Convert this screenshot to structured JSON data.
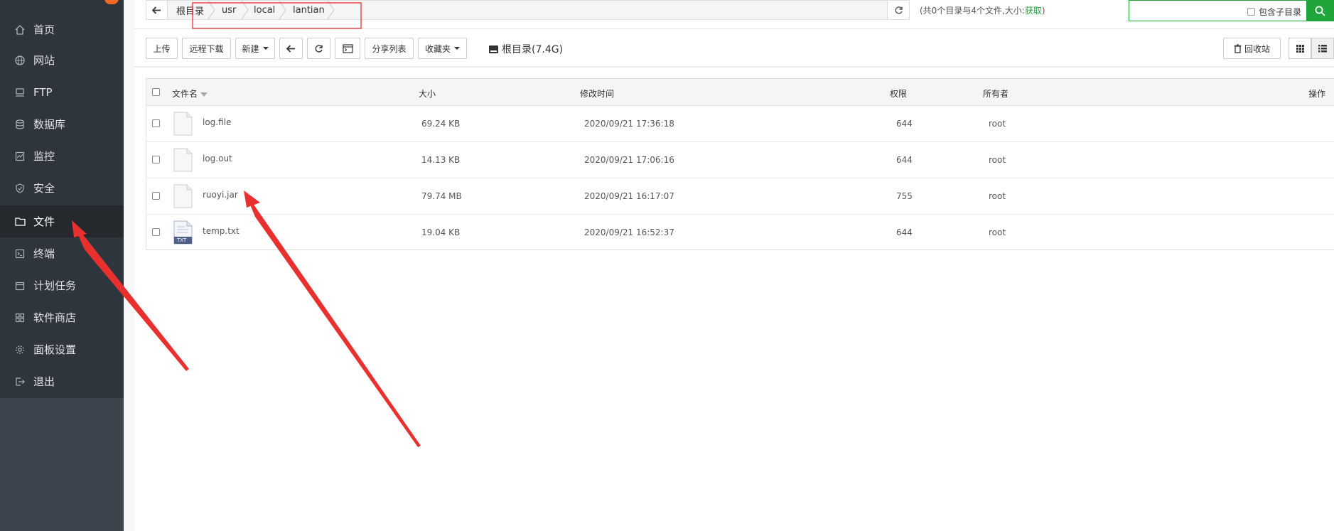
{
  "sidebar": {
    "items": [
      {
        "label": "首页",
        "icon": "home-icon"
      },
      {
        "label": "网站",
        "icon": "globe-icon"
      },
      {
        "label": "FTP",
        "icon": "ftp-icon"
      },
      {
        "label": "数据库",
        "icon": "database-icon"
      },
      {
        "label": "监控",
        "icon": "monitor-icon"
      },
      {
        "label": "安全",
        "icon": "shield-icon"
      },
      {
        "label": "文件",
        "icon": "folder-icon",
        "active": true
      },
      {
        "label": "终端",
        "icon": "terminal-icon"
      },
      {
        "label": "计划任务",
        "icon": "calendar-icon"
      },
      {
        "label": "软件商店",
        "icon": "apps-icon"
      },
      {
        "label": "面板设置",
        "icon": "gear-icon"
      },
      {
        "label": "退出",
        "icon": "logout-icon"
      }
    ]
  },
  "breadcrumb": {
    "items": [
      "根目录",
      "usr",
      "local",
      "lantian"
    ]
  },
  "summary": {
    "text": "(共0个目录与4个文件,大小:",
    "link": "获取",
    "close": ")"
  },
  "search": {
    "placeholder": "",
    "include_sub_label": "包含子目录"
  },
  "toolbar": {
    "upload": "上传",
    "remote_download": "远程下载",
    "new": "新建",
    "share_list": "分享列表",
    "favorites": "收藏夹",
    "disk": "根目录(7.4G)",
    "recycle_bin": "回收站"
  },
  "table": {
    "headers": {
      "name": "文件名",
      "size": "大小",
      "mtime": "修改时间",
      "perm": "权限",
      "owner": "所有者",
      "ops": "操作"
    },
    "rows": [
      {
        "name": "log.file",
        "size": "69.24 KB",
        "mtime": "2020/09/21 17:36:18",
        "perm": "644",
        "owner": "root",
        "type": "file"
      },
      {
        "name": "log.out",
        "size": "14.13 KB",
        "mtime": "2020/09/21 17:06:16",
        "perm": "644",
        "owner": "root",
        "type": "file"
      },
      {
        "name": "ruoyi.jar",
        "size": "79.74 MB",
        "mtime": "2020/09/21 16:17:07",
        "perm": "755",
        "owner": "root",
        "type": "file"
      },
      {
        "name": "temp.txt",
        "size": "19.04 KB",
        "mtime": "2020/09/21 16:52:37",
        "perm": "644",
        "owner": "root",
        "type": "txt",
        "badge": "TXT"
      }
    ]
  },
  "colors": {
    "sidebar_bg": "#2f353c",
    "accent_green": "#20a53a",
    "annotation_red": "#e8312f"
  }
}
